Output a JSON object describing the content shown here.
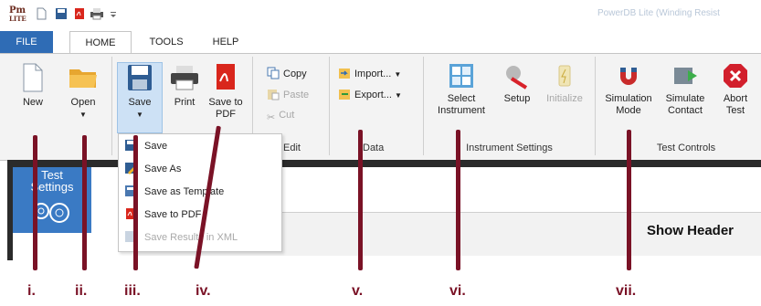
{
  "app": {
    "logo_text": "Pm",
    "logo_sub": "LITE",
    "window_title": "PowerDB Lite (Winding Resist"
  },
  "tabs": [
    {
      "label": "FILE"
    },
    {
      "label": "HOME"
    },
    {
      "label": "TOOLS"
    },
    {
      "label": "HELP"
    }
  ],
  "ribbon": {
    "file_group": {
      "new": "New",
      "open": "Open"
    },
    "save_group": {
      "save": "Save",
      "print": "Print",
      "save_to_pdf": "Save to PDF"
    },
    "edit_group": {
      "copy": "Copy",
      "paste": "Paste",
      "cut": "Cut",
      "label": "Edit"
    },
    "data_group": {
      "import": "Import...",
      "export": "Export...",
      "label": "Data"
    },
    "instrument_group": {
      "select": "Select Instrument",
      "setup": "Setup",
      "initialize": "Initialize",
      "label": "Instrument Settings"
    },
    "test_group": {
      "simulation_mode": "Simulation Mode",
      "simulate_contact": "Simulate Contact",
      "abort_test": "Abort Test",
      "label": "Test Controls"
    }
  },
  "save_menu": {
    "items": [
      {
        "label": "Save",
        "enabled": true
      },
      {
        "label": "Save As",
        "enabled": true
      },
      {
        "label": "Save as Template",
        "enabled": true
      },
      {
        "label": "Save to PDF",
        "enabled": true
      },
      {
        "label": "Save Results in XML",
        "enabled": false
      }
    ]
  },
  "panel": {
    "tile_label": "Test Settings",
    "show_header": "Show Header"
  },
  "annotations": [
    "i.",
    "ii.",
    "iii.",
    "iv.",
    "v.",
    "vi.",
    "vii."
  ],
  "colors": {
    "file_tab": "#2f6cb5",
    "accent_arrow": "#7a1226",
    "tile": "#3a7ac4"
  }
}
